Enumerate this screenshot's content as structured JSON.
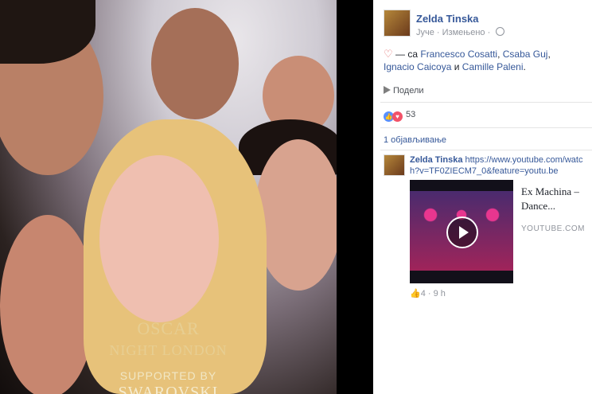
{
  "photo": {
    "overlay_lines": [
      "OSCAR",
      "NIGHT LONDON",
      "SUPPORTED BY",
      "SWAROVSKI"
    ]
  },
  "post": {
    "author": "Zelda Tinska",
    "time": "Јуче",
    "edited": "Измењено",
    "privacy_icon": "globe-icon",
    "feeling_icon": "heart",
    "text_prefix": "— са",
    "tagged": [
      "Francesco Cosatti",
      "Csaba Guj",
      "Ignacio Caicoya"
    ],
    "tagged_last": "Camille Paleni",
    "and_word": "и",
    "share_label": "Подели",
    "reaction_count": "53",
    "replies_label": "1 објављивање"
  },
  "comment": {
    "author": "Zelda Tinska",
    "link_text": "https://www.youtube.com/watch?v=TF0ZIECM7_0&feature=youtu.be",
    "card_title": "Ex Machina – Dance...",
    "card_host": "YOUTUBE.COM",
    "likes": "4",
    "time": "9 h"
  },
  "colors": {
    "link": "#365899",
    "like": "#5890ff",
    "love": "#f25268"
  }
}
